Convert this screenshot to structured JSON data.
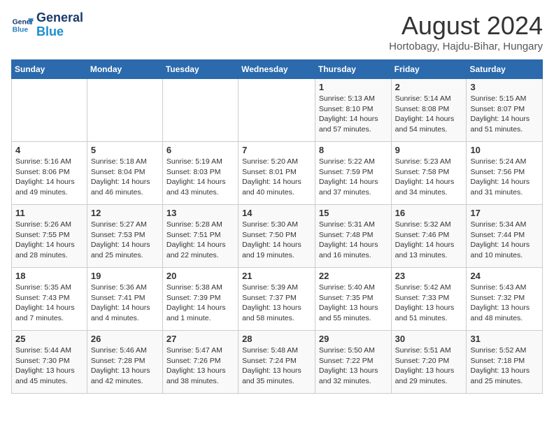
{
  "logo": {
    "line1": "General",
    "line2": "Blue"
  },
  "title": "August 2024",
  "subtitle": "Hortobagy, Hajdu-Bihar, Hungary",
  "days_of_week": [
    "Sunday",
    "Monday",
    "Tuesday",
    "Wednesday",
    "Thursday",
    "Friday",
    "Saturday"
  ],
  "weeks": [
    [
      {
        "day": "",
        "info": ""
      },
      {
        "day": "",
        "info": ""
      },
      {
        "day": "",
        "info": ""
      },
      {
        "day": "",
        "info": ""
      },
      {
        "day": "1",
        "info": "Sunrise: 5:13 AM\nSunset: 8:10 PM\nDaylight: 14 hours\nand 57 minutes."
      },
      {
        "day": "2",
        "info": "Sunrise: 5:14 AM\nSunset: 8:08 PM\nDaylight: 14 hours\nand 54 minutes."
      },
      {
        "day": "3",
        "info": "Sunrise: 5:15 AM\nSunset: 8:07 PM\nDaylight: 14 hours\nand 51 minutes."
      }
    ],
    [
      {
        "day": "4",
        "info": "Sunrise: 5:16 AM\nSunset: 8:06 PM\nDaylight: 14 hours\nand 49 minutes."
      },
      {
        "day": "5",
        "info": "Sunrise: 5:18 AM\nSunset: 8:04 PM\nDaylight: 14 hours\nand 46 minutes."
      },
      {
        "day": "6",
        "info": "Sunrise: 5:19 AM\nSunset: 8:03 PM\nDaylight: 14 hours\nand 43 minutes."
      },
      {
        "day": "7",
        "info": "Sunrise: 5:20 AM\nSunset: 8:01 PM\nDaylight: 14 hours\nand 40 minutes."
      },
      {
        "day": "8",
        "info": "Sunrise: 5:22 AM\nSunset: 7:59 PM\nDaylight: 14 hours\nand 37 minutes."
      },
      {
        "day": "9",
        "info": "Sunrise: 5:23 AM\nSunset: 7:58 PM\nDaylight: 14 hours\nand 34 minutes."
      },
      {
        "day": "10",
        "info": "Sunrise: 5:24 AM\nSunset: 7:56 PM\nDaylight: 14 hours\nand 31 minutes."
      }
    ],
    [
      {
        "day": "11",
        "info": "Sunrise: 5:26 AM\nSunset: 7:55 PM\nDaylight: 14 hours\nand 28 minutes."
      },
      {
        "day": "12",
        "info": "Sunrise: 5:27 AM\nSunset: 7:53 PM\nDaylight: 14 hours\nand 25 minutes."
      },
      {
        "day": "13",
        "info": "Sunrise: 5:28 AM\nSunset: 7:51 PM\nDaylight: 14 hours\nand 22 minutes."
      },
      {
        "day": "14",
        "info": "Sunrise: 5:30 AM\nSunset: 7:50 PM\nDaylight: 14 hours\nand 19 minutes."
      },
      {
        "day": "15",
        "info": "Sunrise: 5:31 AM\nSunset: 7:48 PM\nDaylight: 14 hours\nand 16 minutes."
      },
      {
        "day": "16",
        "info": "Sunrise: 5:32 AM\nSunset: 7:46 PM\nDaylight: 14 hours\nand 13 minutes."
      },
      {
        "day": "17",
        "info": "Sunrise: 5:34 AM\nSunset: 7:44 PM\nDaylight: 14 hours\nand 10 minutes."
      }
    ],
    [
      {
        "day": "18",
        "info": "Sunrise: 5:35 AM\nSunset: 7:43 PM\nDaylight: 14 hours\nand 7 minutes."
      },
      {
        "day": "19",
        "info": "Sunrise: 5:36 AM\nSunset: 7:41 PM\nDaylight: 14 hours\nand 4 minutes."
      },
      {
        "day": "20",
        "info": "Sunrise: 5:38 AM\nSunset: 7:39 PM\nDaylight: 14 hours\nand 1 minute."
      },
      {
        "day": "21",
        "info": "Sunrise: 5:39 AM\nSunset: 7:37 PM\nDaylight: 13 hours\nand 58 minutes."
      },
      {
        "day": "22",
        "info": "Sunrise: 5:40 AM\nSunset: 7:35 PM\nDaylight: 13 hours\nand 55 minutes."
      },
      {
        "day": "23",
        "info": "Sunrise: 5:42 AM\nSunset: 7:33 PM\nDaylight: 13 hours\nand 51 minutes."
      },
      {
        "day": "24",
        "info": "Sunrise: 5:43 AM\nSunset: 7:32 PM\nDaylight: 13 hours\nand 48 minutes."
      }
    ],
    [
      {
        "day": "25",
        "info": "Sunrise: 5:44 AM\nSunset: 7:30 PM\nDaylight: 13 hours\nand 45 minutes."
      },
      {
        "day": "26",
        "info": "Sunrise: 5:46 AM\nSunset: 7:28 PM\nDaylight: 13 hours\nand 42 minutes."
      },
      {
        "day": "27",
        "info": "Sunrise: 5:47 AM\nSunset: 7:26 PM\nDaylight: 13 hours\nand 38 minutes."
      },
      {
        "day": "28",
        "info": "Sunrise: 5:48 AM\nSunset: 7:24 PM\nDaylight: 13 hours\nand 35 minutes."
      },
      {
        "day": "29",
        "info": "Sunrise: 5:50 AM\nSunset: 7:22 PM\nDaylight: 13 hours\nand 32 minutes."
      },
      {
        "day": "30",
        "info": "Sunrise: 5:51 AM\nSunset: 7:20 PM\nDaylight: 13 hours\nand 29 minutes."
      },
      {
        "day": "31",
        "info": "Sunrise: 5:52 AM\nSunset: 7:18 PM\nDaylight: 13 hours\nand 25 minutes."
      }
    ]
  ]
}
